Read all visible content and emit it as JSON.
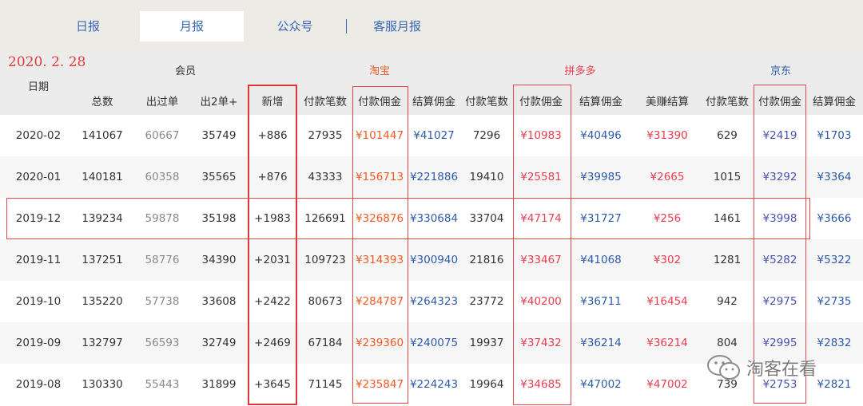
{
  "tabs": [
    {
      "label": "日报",
      "active": false
    },
    {
      "label": "月报",
      "active": true
    },
    {
      "label": "公众号",
      "active": false
    },
    {
      "label": "客服月报",
      "active": false
    }
  ],
  "header": {
    "date_stamp": "2020. 2. 28",
    "date_label": "日期",
    "groups": [
      "会员",
      "淘宝",
      "拼多多",
      "京东"
    ],
    "columns": [
      "总数",
      "出过单",
      "出2单+",
      "新增",
      "付款笔数",
      "付款佣金",
      "结算佣金",
      "付款笔数",
      "付款佣金",
      "结算佣金",
      "美赚结算",
      "付款笔数",
      "付款佣金",
      "结算佣金"
    ]
  },
  "rows": [
    [
      "2020-02",
      "141067",
      "60667",
      "35749",
      "+886",
      "27935",
      "¥101447",
      "¥41027",
      "7296",
      "¥10983",
      "¥40496",
      "¥31390",
      "629",
      "¥2419",
      "¥1703"
    ],
    [
      "2020-01",
      "140181",
      "60358",
      "35565",
      "+876",
      "43333",
      "¥156713",
      "¥221886",
      "19410",
      "¥25581",
      "¥39985",
      "¥2665",
      "1015",
      "¥3292",
      "¥3364"
    ],
    [
      "2019-12",
      "139234",
      "59878",
      "35198",
      "+1983",
      "126691",
      "¥326876",
      "¥330684",
      "33704",
      "¥47174",
      "¥31727",
      "¥256",
      "1461",
      "¥3998",
      "¥3666"
    ],
    [
      "2019-11",
      "137251",
      "58776",
      "34390",
      "+2031",
      "109723",
      "¥314393",
      "¥300940",
      "21816",
      "¥33467",
      "¥41068",
      "¥302",
      "1281",
      "¥5282",
      "¥5322"
    ],
    [
      "2019-10",
      "135220",
      "57738",
      "33608",
      "+2422",
      "80673",
      "¥284787",
      "¥264323",
      "23772",
      "¥40200",
      "¥36711",
      "¥16454",
      "942",
      "¥2975",
      "¥2735"
    ],
    [
      "2019-09",
      "132797",
      "56593",
      "32749",
      "+2469",
      "67184",
      "¥239360",
      "¥240075",
      "19937",
      "¥37432",
      "¥36214",
      "¥36214",
      "804",
      "¥2995",
      "¥2832"
    ],
    [
      "2019-08",
      "130330",
      "55443",
      "31899",
      "+3645",
      "71145",
      "¥235847",
      "¥224243",
      "19964",
      "¥34685",
      "¥47002",
      "¥47002",
      "739",
      "¥2753",
      "¥2821"
    ]
  ],
  "watermark": {
    "text": "淘客在看",
    "icon": "wechat-icon"
  },
  "colors": {
    "tab_text": "#3a68b5",
    "taobao_group": "#f05a24",
    "pinduoduo_group": "#ea3d4f",
    "jd_group": "#2d5aa8",
    "highlight_box": "#e0353b",
    "date_stamp": "#e33b3b"
  }
}
